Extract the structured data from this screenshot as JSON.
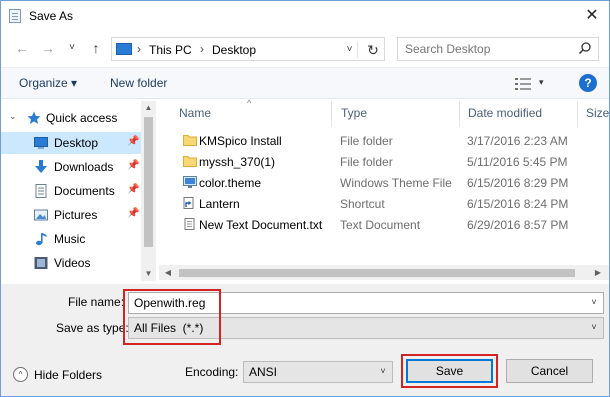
{
  "window": {
    "title": "Save As",
    "close_glyph": "✕"
  },
  "nav_buttons": {
    "back": "←",
    "forward": "→",
    "recent": "˅",
    "up": "↑"
  },
  "address": {
    "crumbs": [
      "This PC",
      "Desktop"
    ],
    "separator": "›",
    "dropdown": "˅",
    "refresh": "↻"
  },
  "search": {
    "placeholder": "Search Desktop"
  },
  "toolbar": {
    "organize": "Organize ▾",
    "new_folder": "New folder",
    "view_dropdown": "▾",
    "help": "?"
  },
  "sidebar": {
    "items": [
      {
        "label": "Quick access",
        "icon": "star-icon"
      },
      {
        "label": "Desktop",
        "icon": "desktop-folder-icon",
        "pinned": true,
        "selected": true
      },
      {
        "label": "Downloads",
        "icon": "download-arrow-icon",
        "pinned": true
      },
      {
        "label": "Documents",
        "icon": "documents-icon",
        "pinned": true
      },
      {
        "label": "Pictures",
        "icon": "pictures-icon",
        "pinned": true
      },
      {
        "label": "Music",
        "icon": "music-note-icon"
      },
      {
        "label": "Videos",
        "icon": "videos-icon"
      }
    ],
    "pin_glyph": "📌"
  },
  "file_list": {
    "columns": [
      "Name",
      "Type",
      "Date modified",
      "Size"
    ],
    "sort_glyph": "^",
    "rows": [
      {
        "name": "KMSpico Install",
        "type": "File folder",
        "date": "3/17/2016 2:23 AM",
        "icon": "folder-icon"
      },
      {
        "name": "myssh_370(1)",
        "type": "File folder",
        "date": "5/11/2016 5:45 PM",
        "icon": "folder-icon"
      },
      {
        "name": "color.theme",
        "type": "Windows Theme File",
        "date": "6/15/2016 8:29 PM",
        "icon": "theme-file-icon"
      },
      {
        "name": "Lantern",
        "type": "Shortcut",
        "date": "6/15/2016 8:24 PM",
        "icon": "shortcut-icon"
      },
      {
        "name": "New Text Document.txt",
        "type": "Text Document",
        "date": "6/29/2016 8:57 PM",
        "icon": "text-file-icon"
      }
    ]
  },
  "form": {
    "file_name_label": "File name:",
    "file_name_value": "Openwith.reg",
    "save_as_type_label": "Save as type:",
    "save_as_type_value": "All Files  (*.*)",
    "encoding_label": "Encoding:",
    "encoding_value": "ANSI",
    "dropdown_glyph": "˅"
  },
  "footer": {
    "hide_folders": "Hide Folders",
    "hide_glyph": "^",
    "save": "Save",
    "cancel": "Cancel"
  },
  "colors": {
    "accent": "#0078d7",
    "highlight_box": "#d32323",
    "selection": "#cce8ff"
  }
}
